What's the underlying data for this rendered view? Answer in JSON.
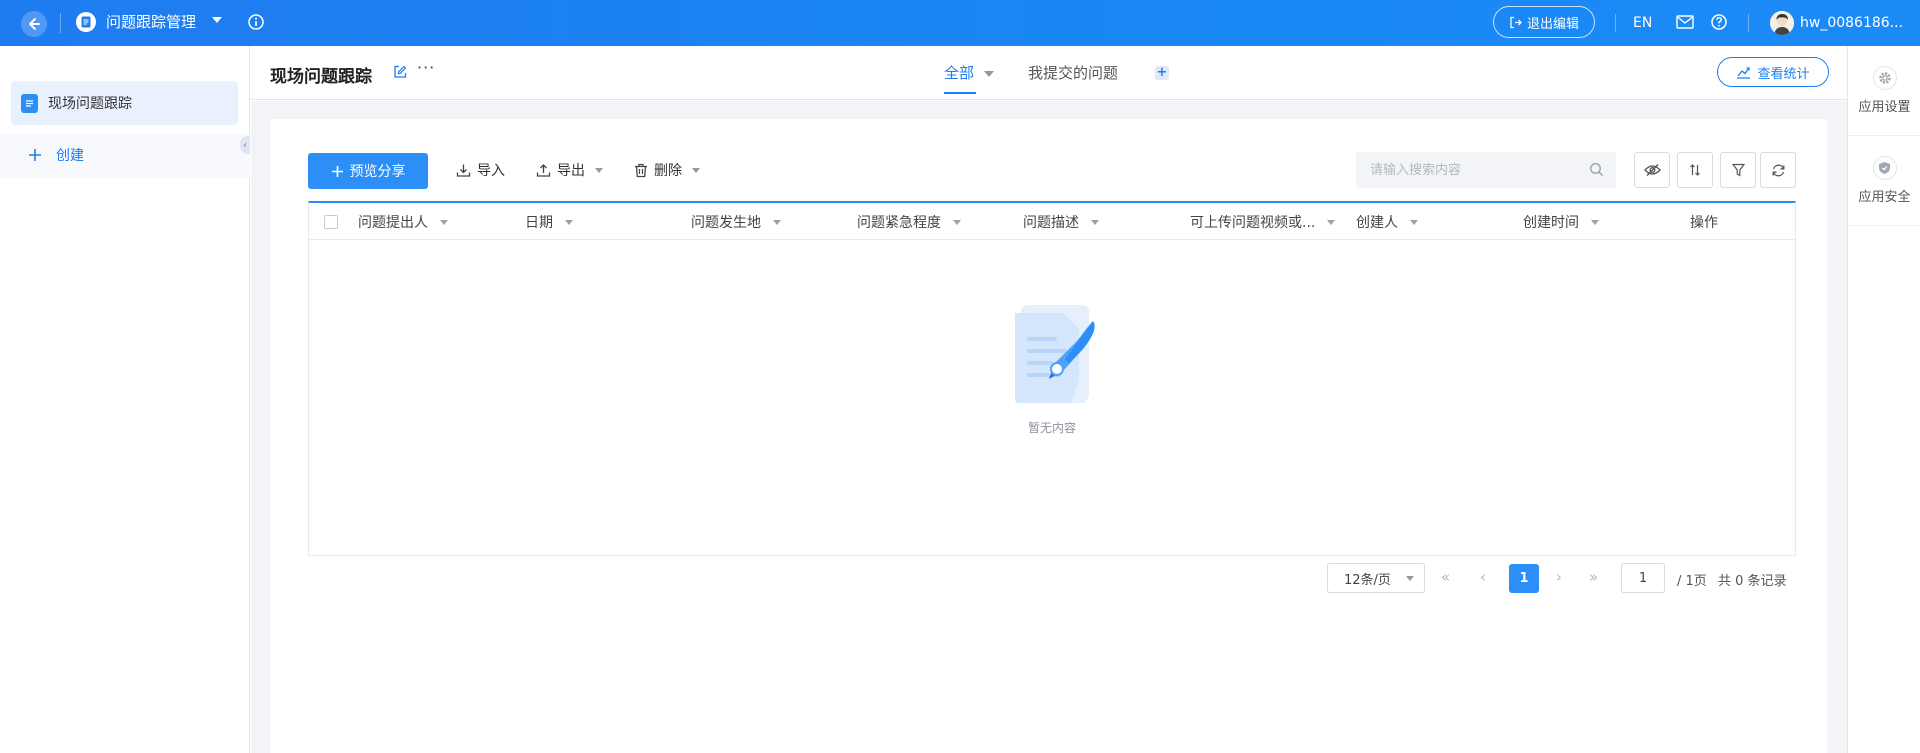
{
  "topbar": {
    "app_title": "问题跟踪管理",
    "exit_label": "退出编辑",
    "lang": "EN",
    "username": "hw_0086186..."
  },
  "sidebar": {
    "items": [
      {
        "label": "现场问题跟踪",
        "active": true
      }
    ],
    "create_label": "创建"
  },
  "header": {
    "page_title": "现场问题跟踪",
    "tabs": [
      {
        "label": "全部",
        "active": true
      },
      {
        "label": "我提交的问题",
        "active": false
      }
    ],
    "stats_label": "查看统计"
  },
  "toolbar": {
    "share_label": "预览分享",
    "import_label": "导入",
    "export_label": "导出",
    "delete_label": "删除",
    "search_placeholder": "请输入搜索内容"
  },
  "table": {
    "columns": [
      "问题提出人",
      "日期",
      "问题发生地",
      "问题紧急程度",
      "问题描述",
      "可上传问题视频或...",
      "创建人",
      "创建时间",
      "操作"
    ],
    "rows": [],
    "empty_text": "暂无内容"
  },
  "pagination": {
    "page_size": "12条/页",
    "current_page": "1",
    "page_input": "1",
    "total_pages": "/ 1页",
    "records": "共 0 条记录"
  },
  "right_rail": {
    "items": [
      {
        "label": "应用设置",
        "icon": "gear-icon"
      },
      {
        "label": "应用安全",
        "icon": "shield-icon"
      }
    ]
  },
  "colors": {
    "primary": "#2b8ff7",
    "topbar": "#1f7cf0",
    "sidebar_active_bg": "#e8f1fd"
  }
}
